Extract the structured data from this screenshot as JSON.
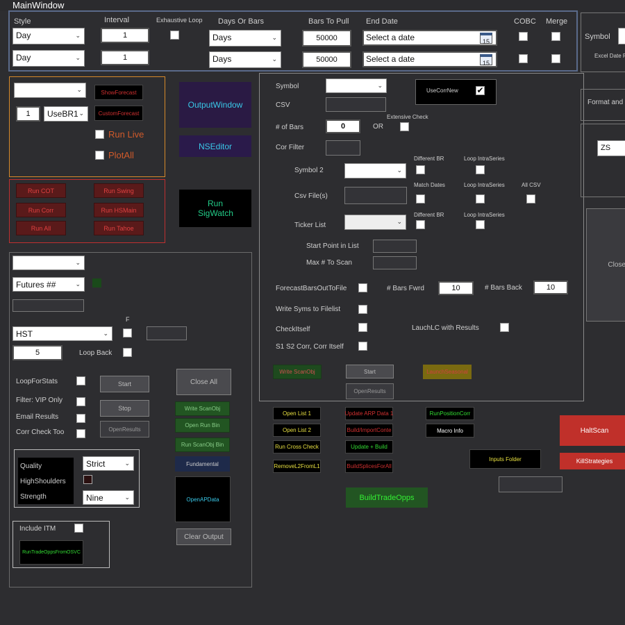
{
  "window": {
    "title": "MainWindow"
  },
  "top": {
    "headers": {
      "style": "Style",
      "interval": "Interval",
      "exhaustive": "Exhaustive Loop",
      "days_or_bars": "Days Or Bars",
      "bars_to_pull": "Bars To Pull",
      "end_date": "End Date",
      "cobc": "COBC",
      "merge": "Merge"
    },
    "row1": {
      "style": "Day",
      "interval": "1",
      "days": "Days",
      "bars": "50000",
      "date_placeholder": "Select a date"
    },
    "row2": {
      "style": "Day",
      "interval": "1",
      "days": "Days",
      "bars": "50000",
      "date_placeholder": "Select a date"
    },
    "calendar_day": "15",
    "symbol_label": "Symbol",
    "excel_date": "Excel Date F"
  },
  "left1": {
    "show_forecast": "ShowForecast",
    "custom_forecast": "CustomForecast",
    "num": "1",
    "usebr": "UseBR1",
    "run_live": "Run Live",
    "plot_all": "PlotAll"
  },
  "mid_buttons": {
    "output_window": "OutputWindow",
    "ns_editor": "NSEditor",
    "run_sigwatch": "Run SigWatch"
  },
  "red_panel": {
    "run_cot": "Run COT",
    "run_swing": "Run Swing",
    "run_corr": "Run Corr",
    "run_hsmain": "Run HSMain",
    "run_all": "Run All",
    "run_tahoe": "Run Tahoe"
  },
  "left3": {
    "futures": "Futures ##",
    "hst": "HST",
    "f_label": "F",
    "five": "5",
    "loop_back": "Loop Back",
    "loop_for_stats": "LoopForStats",
    "filter_vip": "Filter: VIP Only",
    "email_results": "Email Results",
    "corr_check_too": "Corr Check Too",
    "start": "Start",
    "stop": "Stop",
    "open_results": "OpenResults",
    "close_all": "Close All",
    "write_scanobj": "Write ScanObj",
    "open_run_bin": "Open Run Bin",
    "run_scanobj_bin": "Run ScanObj Bin",
    "fundamental": "Fundamental",
    "open_ap_data": "OpenAPData",
    "clear_output": "Clear Output",
    "quality": "Quality",
    "high_shoulders": "HighShoulders",
    "strength": "Strength",
    "strict": "Strict",
    "nine": "Nine",
    "include_itm": "Include ITM",
    "run_trade_opps": "RunTradeOppsFromOSVC"
  },
  "scan": {
    "symbol": "Symbol",
    "csv": "CSV",
    "num_bars": "# of Bars",
    "num_bars_value": "0",
    "or": "OR",
    "extensive_check": "Extensive Check",
    "cor_filter": "Cor Filter",
    "use_corr_new": "UseCorrNew",
    "symbol2": "Symbol 2",
    "different_br": "Different BR",
    "loop_intraseries": "Loop IntraSeries",
    "csv_files": "Csv File(s)",
    "match_dates": "Match Dates",
    "loop_intraseries2": "Loop IntraSeries",
    "all_csv": "All CSV",
    "ticker_list": "Ticker List",
    "different_br2": "Different BR",
    "loop_intraseries3": "Loop IntraSeries",
    "start_point": "Start Point in List",
    "max_to_scan": "Max # To Scan",
    "forecast_bars": "ForecastBarsOutToFile",
    "bars_fwrd": "# Bars Fwrd",
    "bars_fwrd_value": "10",
    "bars_back": "# Bars Back",
    "bars_back_value": "10",
    "write_syms": "Write Syms to Filelist",
    "check_itself": "CheckItself",
    "launch_lc": "LauchLC with Results",
    "s1s2": "S1 S2 Corr, Corr Itself",
    "write_scanobj": "Write ScanObj",
    "start": "Start",
    "launch_seasonal": "LaunchSeasonal",
    "open_results": "OpenResults"
  },
  "bottom": {
    "open_list1": "Open List 1",
    "open_list2": "Open List 2",
    "run_cross_check": "Run Cross Check",
    "remove_l2": "RemoveL2FromL1",
    "update_arp": "Update ARP Data 1",
    "build_import": "Build/ImportConte",
    "update_build": "Update + Build",
    "build_splices": "BuildSplicesForAll",
    "run_position_corr": "RunPositionCorr",
    "macro_info": "Macro Info",
    "inputs_folder": "Inputs Folder",
    "build_trade_opps": "BuildTradeOpps",
    "halt_scan": "HaltScan",
    "kill_strategies": "KillStrategies"
  },
  "right": {
    "format_and": "Format and",
    "zs": "ZS",
    "close": "Close"
  }
}
